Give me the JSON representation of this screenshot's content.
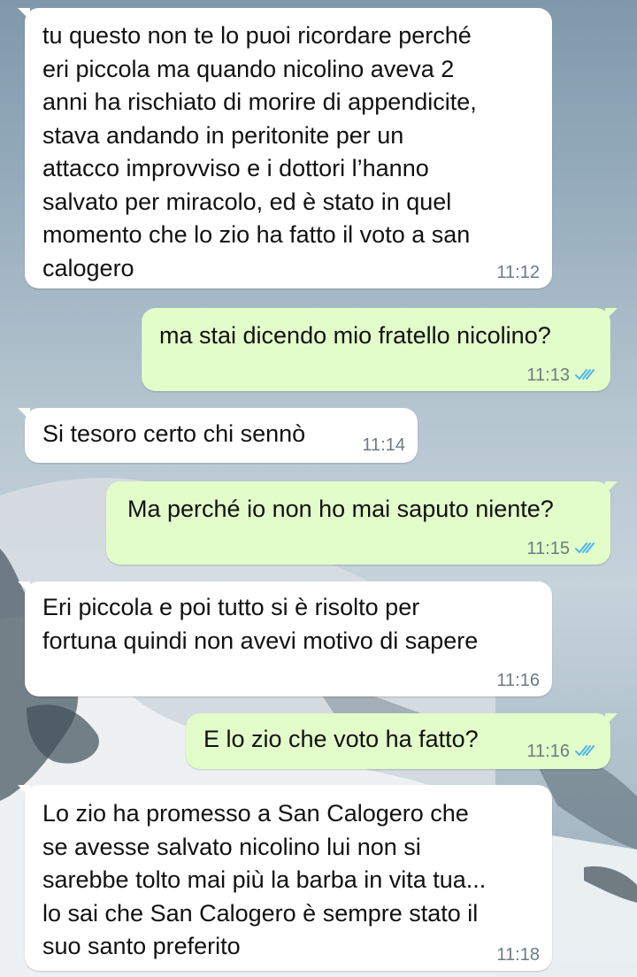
{
  "colors": {
    "incoming_bubble": "#ffffff",
    "outgoing_bubble": "#e2fdc9",
    "timestamp": "#6d7b82",
    "read_ticks": "#4fb6ec"
  },
  "messages": [
    {
      "direction": "incoming",
      "text": "tu questo non te lo puoi ricordare perché\neri piccola ma quando nicolino aveva 2\nanni ha rischiato di morire di appendicite,\nstava andando in peritonite per un\nattacco improvviso e i dottori l’hanno\nsalvato per miracolo, ed è stato in quel\nmomento che lo zio ha fatto il voto a san\ncalogero",
      "time": "11:12"
    },
    {
      "direction": "outgoing",
      "text": "ma stai dicendo mio fratello nicolino?",
      "time": "11:13",
      "status_icon": "read-double-check-icon"
    },
    {
      "direction": "incoming",
      "text": "Si tesoro certo chi sennò",
      "time": "11:14"
    },
    {
      "direction": "outgoing",
      "text": "Ma perché io non ho mai saputo niente?",
      "time": "11:15",
      "status_icon": "read-double-check-icon"
    },
    {
      "direction": "incoming",
      "text": "Eri piccola e poi tutto si è risolto per\nfortuna quindi non avevi motivo di sapere",
      "time": "11:16"
    },
    {
      "direction": "outgoing",
      "text": "E lo zio che voto ha fatto?",
      "time": "11:16",
      "status_icon": "read-double-check-icon"
    },
    {
      "direction": "incoming",
      "text": "Lo zio ha promesso a San Calogero che\nse avesse salvato nicolino lui non si\nsarebbe tolto mai più la barba in vita tua...\nlo sai che San Calogero è sempre stato il\nsuo santo preferito",
      "time": "11:18"
    }
  ]
}
